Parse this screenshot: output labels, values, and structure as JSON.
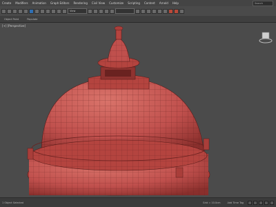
{
  "menu": {
    "items": [
      "Create",
      "Modifiers",
      "Animation",
      "Graph Editors",
      "Rendering",
      "Civil View",
      "Customize",
      "Scripting",
      "Content",
      "Arnold",
      "Help"
    ],
    "search_placeholder": "Search"
  },
  "toolbar": {
    "view_select": "View"
  },
  "ribbon": {
    "tabs": [
      "Object Paint",
      "Populate"
    ]
  },
  "viewport": {
    "label": "[+] [Perspective]",
    "model_color": "#c0504d",
    "wire_color": "#5a1c1a"
  },
  "status": {
    "message": "1 Object Selected",
    "coord": "Grid = 10.0cm",
    "add_time_tag": "Add Time Tag"
  }
}
